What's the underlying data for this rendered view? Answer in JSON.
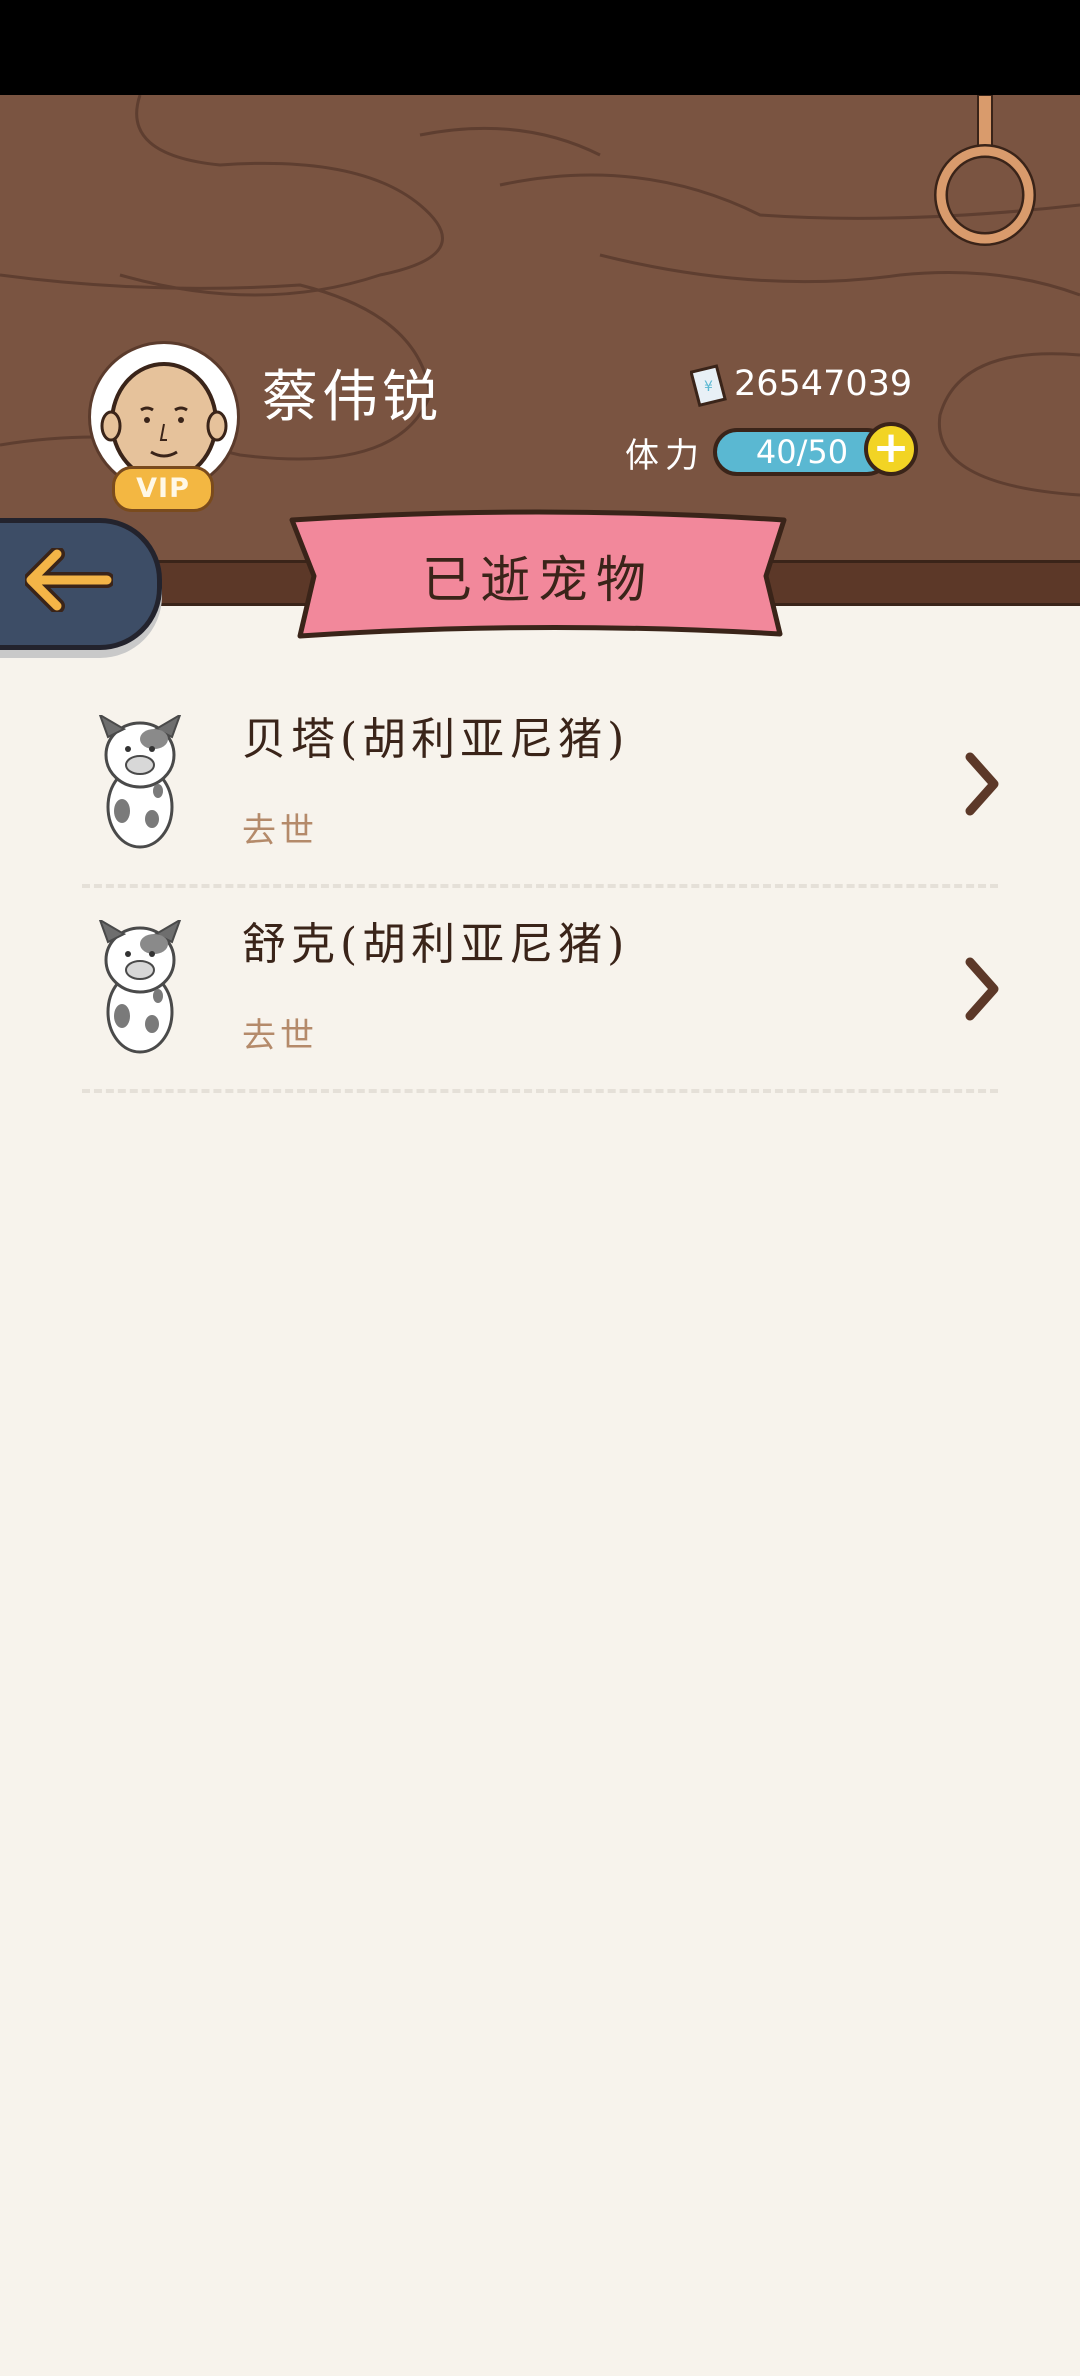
{
  "header": {
    "user_name": "蔡伟锐",
    "vip_label": "VIP",
    "coins": "26547039",
    "stamina_label": "体力",
    "stamina": "40/50",
    "stamina_plus": "+"
  },
  "page": {
    "title": "已逝宠物"
  },
  "pets": [
    {
      "name": "贝塔(胡利亚尼猪)",
      "status": "去世"
    },
    {
      "name": "舒克(胡利亚尼猪)",
      "status": "去世"
    }
  ],
  "colors": {
    "wood": "#7a5441",
    "ribbon": "#f2889b",
    "background": "#f7f3ec",
    "stamina_bar": "#5ab8d2",
    "back_button": "#3d4d66"
  },
  "icons": {
    "back": "arrow-left-icon",
    "coin": "ticket-icon",
    "pet": "pig-icon",
    "row_action": "chevron-right-icon",
    "ring": "ring-icon"
  }
}
